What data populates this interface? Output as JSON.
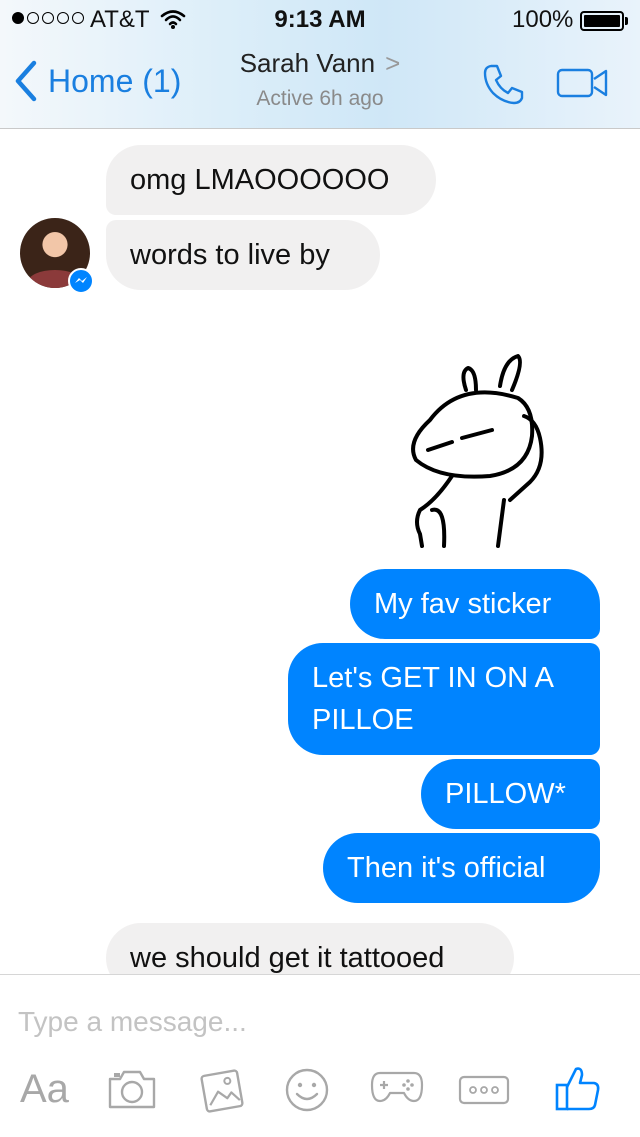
{
  "status_bar": {
    "carrier": "AT&T",
    "time": "9:13 AM",
    "battery": "100%",
    "signal_bars": 1,
    "signal_total": 5
  },
  "nav": {
    "back_label": "Home (1)",
    "contact_name": "Sarah Vann",
    "contact_chevron": ">",
    "contact_status": "Active 6h ago"
  },
  "messages": [
    {
      "direction": "in",
      "text": "omg LMAOOOOOO"
    },
    {
      "direction": "in",
      "text": "words to live by"
    },
    {
      "direction": "out",
      "type": "sticker",
      "sticker": "bunny-sticker"
    },
    {
      "direction": "out",
      "text": "My fav sticker"
    },
    {
      "direction": "out",
      "text": "Let's GET IN ON A PILLOE"
    },
    {
      "direction": "out",
      "text": "PILLOW*"
    },
    {
      "direction": "out",
      "text": "Then it's official"
    },
    {
      "direction": "in",
      "text": "we should get it tattooed"
    }
  ],
  "composer": {
    "placeholder": "Type a message...",
    "aa_label": "Aa",
    "tools": [
      "text-format-icon",
      "camera-icon",
      "gallery-icon",
      "emoji-icon",
      "games-icon",
      "more-icon",
      "like-icon"
    ]
  },
  "colors": {
    "accent": "#0084ff",
    "link": "#1a7fe0",
    "incoming_bubble": "#f1f0f0",
    "icon_gray": "#a8a8a8"
  }
}
